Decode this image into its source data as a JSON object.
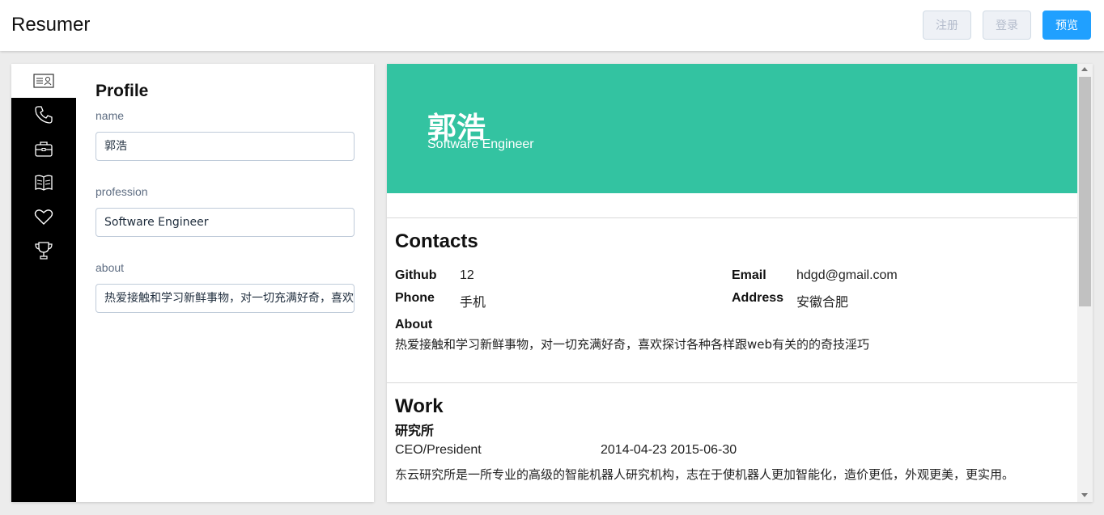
{
  "app": {
    "title": "Resumer"
  },
  "header": {
    "register_label": "注册",
    "login_label": "登录",
    "preview_label": "预览"
  },
  "sidebar": {
    "items": [
      {
        "icon": "id-card-icon",
        "active": true
      },
      {
        "icon": "phone-icon",
        "active": false
      },
      {
        "icon": "briefcase-icon",
        "active": false
      },
      {
        "icon": "book-icon",
        "active": false
      },
      {
        "icon": "heart-icon",
        "active": false
      },
      {
        "icon": "trophy-icon",
        "active": false
      }
    ]
  },
  "form": {
    "title": "Profile",
    "fields": [
      {
        "label": "name",
        "value": "郭浩"
      },
      {
        "label": "profession",
        "value": "Software Engineer"
      },
      {
        "label": "about",
        "value": "热爱接触和学习新鲜事物，对一切充满好奇，喜欢探讨各种各样跟web有关的的奇技淫巧"
      }
    ]
  },
  "preview": {
    "name": "郭浩",
    "profession": "Software Engineer",
    "contacts": {
      "title": "Contacts",
      "github_label": "Github",
      "github": "12",
      "email_label": "Email",
      "email": "hdgd@gmail.com",
      "phone_label": "Phone",
      "phone": "手机",
      "address_label": "Address",
      "address": "安徽合肥",
      "about_label": "About",
      "about": "热爱接触和学习新鲜事物，对一切充满好奇，喜欢探讨各种各样跟web有关的的奇技淫巧"
    },
    "work": {
      "title": "Work",
      "organization": "研究所",
      "position": "CEO/President",
      "dates": "2014-04-23 2015-06-30",
      "description": "东云研究所是一所专业的高级的智能机器人研究机构，志在于使机器人更加智能化，造价更低，外观更美，更实用。"
    }
  },
  "colors": {
    "accent": "#20a0ff",
    "hero": "#33c3a1",
    "sidebar": "#000000"
  }
}
